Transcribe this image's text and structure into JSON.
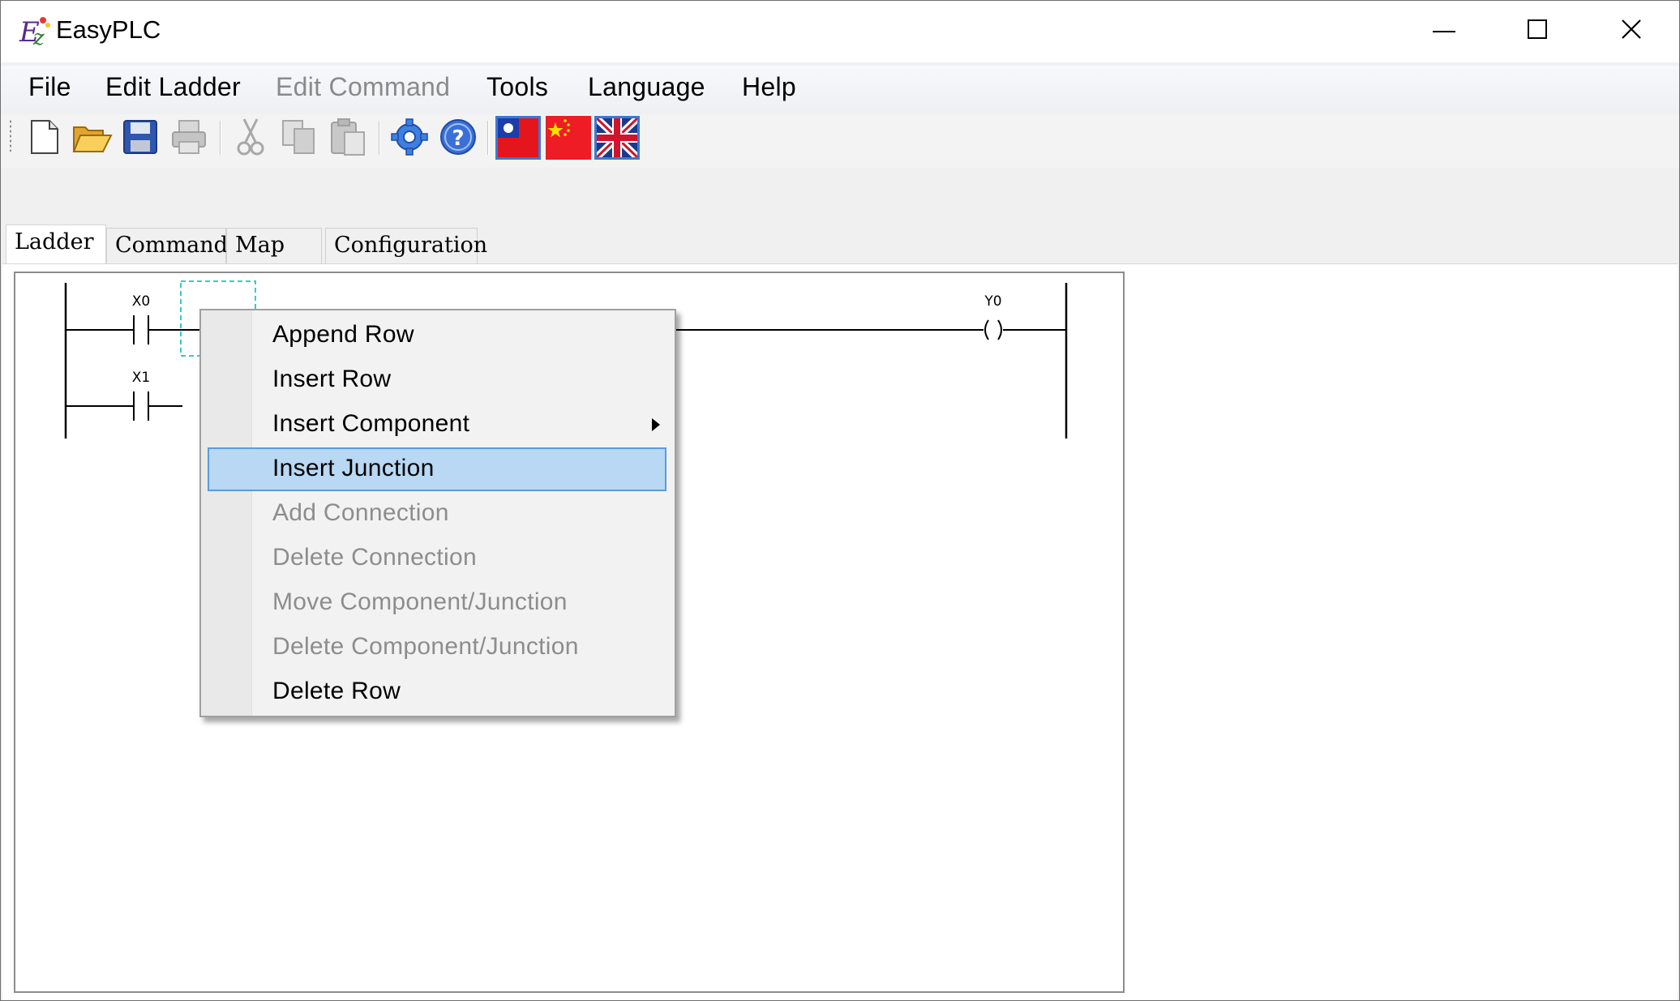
{
  "window": {
    "title": "EasyPLC",
    "controls": {
      "minimize": "minimize",
      "maximize": "maximize",
      "close": "close"
    }
  },
  "menubar": {
    "items": [
      {
        "label": "File",
        "enabled": true
      },
      {
        "label": "Edit Ladder",
        "enabled": true
      },
      {
        "label": "Edit Command",
        "enabled": false
      },
      {
        "label": "Tools",
        "enabled": true
      },
      {
        "label": "Language",
        "enabled": true
      },
      {
        "label": "Help",
        "enabled": true
      }
    ]
  },
  "toolbar": {
    "buttons": [
      {
        "icon": "new-file-icon",
        "enabled": true
      },
      {
        "icon": "open-folder-icon",
        "enabled": true
      },
      {
        "icon": "save-icon",
        "enabled": true
      },
      {
        "icon": "print-icon",
        "enabled": false
      },
      {
        "icon": "cut-icon",
        "enabled": false
      },
      {
        "icon": "copy-icon",
        "enabled": false
      },
      {
        "icon": "paste-icon",
        "enabled": false
      },
      {
        "icon": "settings-gear-icon",
        "enabled": true
      },
      {
        "icon": "help-icon",
        "enabled": true
      }
    ],
    "language_flags": [
      {
        "icon": "flag-taiwan-icon",
        "selected": true
      },
      {
        "icon": "flag-china-icon",
        "selected": false
      },
      {
        "icon": "flag-uk-icon",
        "selected": true
      }
    ]
  },
  "tabs": [
    {
      "label": "Ladder",
      "active": true
    },
    {
      "label": "Command",
      "active": false
    },
    {
      "label": "Map",
      "active": false
    },
    {
      "label": "Configuration",
      "active": false
    }
  ],
  "ladder": {
    "rungs": [
      {
        "contact": "X0",
        "coil": "Y0"
      },
      {
        "contact": "X1",
        "coil": ""
      }
    ]
  },
  "context_menu": {
    "items": [
      {
        "label": "Append Row",
        "enabled": true,
        "highlighted": false
      },
      {
        "label": "Insert Row",
        "enabled": true,
        "highlighted": false
      },
      {
        "label": "Insert Component",
        "enabled": true,
        "highlighted": false,
        "has_submenu": true
      },
      {
        "label": "Insert Junction",
        "enabled": true,
        "highlighted": true
      },
      {
        "label": "Add Connection",
        "enabled": false,
        "highlighted": false
      },
      {
        "label": "Delete Connection",
        "enabled": false,
        "highlighted": false
      },
      {
        "label": "Move Component/Junction",
        "enabled": false,
        "highlighted": false
      },
      {
        "label": "Delete Component/Junction",
        "enabled": false,
        "highlighted": false
      },
      {
        "label": "Delete Row",
        "enabled": true,
        "highlighted": false
      }
    ]
  },
  "colors": {
    "highlight_bg": "#b8d8f4",
    "highlight_border": "#5b9be0",
    "disabled_text": "#8d8d8d",
    "selection_box": "#33cccc"
  }
}
